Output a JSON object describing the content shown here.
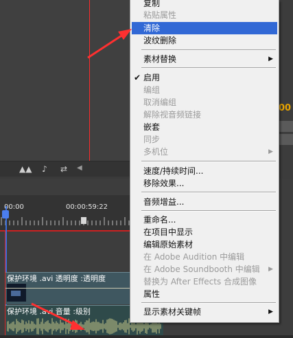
{
  "timeline": {
    "timecode_start": "00:00",
    "timecode_mid": "00:00:59:22"
  },
  "clips": {
    "video_label": "保护环境 .avi  透明度 :透明度",
    "audio_label": "保护环境 .avi  音量 :级别"
  },
  "right_strip": {
    "partial_timecode": "00"
  },
  "context_menu": {
    "items": [
      {
        "label": "复制",
        "enabled": true
      },
      {
        "label": "粘贴属性",
        "enabled": false
      },
      {
        "label": "清除",
        "enabled": true,
        "highlighted": true
      },
      {
        "label": "波纹删除",
        "enabled": true
      },
      {
        "label": "素材替换",
        "enabled": true,
        "submenu": true
      },
      {
        "label": "启用",
        "enabled": true,
        "checked": true
      },
      {
        "label": "编组",
        "enabled": false
      },
      {
        "label": "取消编组",
        "enabled": false
      },
      {
        "label": "解除视音频链接",
        "enabled": false
      },
      {
        "label": "嵌套",
        "enabled": true
      },
      {
        "label": "同步",
        "enabled": false
      },
      {
        "label": "多机位",
        "enabled": false,
        "submenu": true
      },
      {
        "label": "速度/持续时间...",
        "enabled": true
      },
      {
        "label": "移除效果...",
        "enabled": true
      },
      {
        "label": "音频增益...",
        "enabled": true
      },
      {
        "label": "重命名...",
        "enabled": true
      },
      {
        "label": "在项目中显示",
        "enabled": true
      },
      {
        "label": "编辑原始素材",
        "enabled": true
      },
      {
        "label": "在 Adobe Audition 中编辑",
        "enabled": false
      },
      {
        "label": "在 Adobe Soundbooth 中编辑",
        "enabled": false,
        "submenu": true
      },
      {
        "label": "替换为 After Effects 合成图像",
        "enabled": false
      },
      {
        "label": "属性",
        "enabled": true
      },
      {
        "label": "显示素材关键帧",
        "enabled": true,
        "submenu": true
      }
    ],
    "submenu_arrow": "▶",
    "check_mark": "✔"
  },
  "colors": {
    "highlight": "#3168d5",
    "annotation_arrow": "#ff3030",
    "playhead": "#3a6edb"
  },
  "icons": {
    "check": "check-icon",
    "submenu": "submenu-arrow-icon",
    "annotation": "red-arrow"
  }
}
